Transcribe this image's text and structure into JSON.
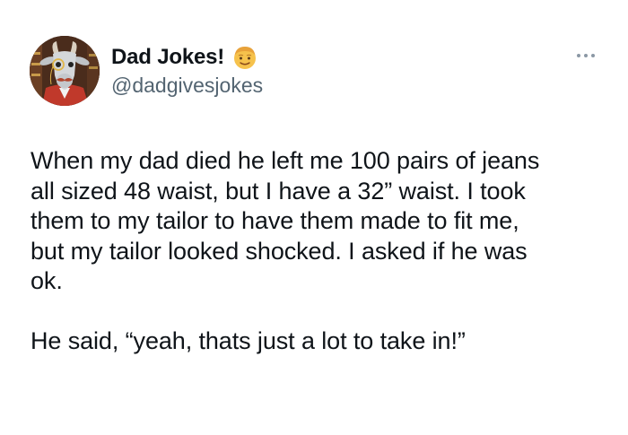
{
  "author": {
    "display_name": "Dad Jokes!",
    "handle": "@dadgivesjokes",
    "avatar_icon": "goat-with-monocle-avatar",
    "badge_icon": "man-emoji-icon"
  },
  "actions": {
    "more_icon": "more-options-icon"
  },
  "tweet": {
    "paragraphs": [
      "When my dad died he left me 100 pairs of jeans\nall sized 48 waist, but I have a 32” waist. I took\nthem to my tailor to have them made to fit me,\nbut my tailor looked shocked. I asked if he was\nok.",
      "He said, “yeah, thats just a lot to take in!”"
    ]
  },
  "colors": {
    "text": "#0f1419",
    "secondary_text": "#536471",
    "background": "#ffffff"
  }
}
